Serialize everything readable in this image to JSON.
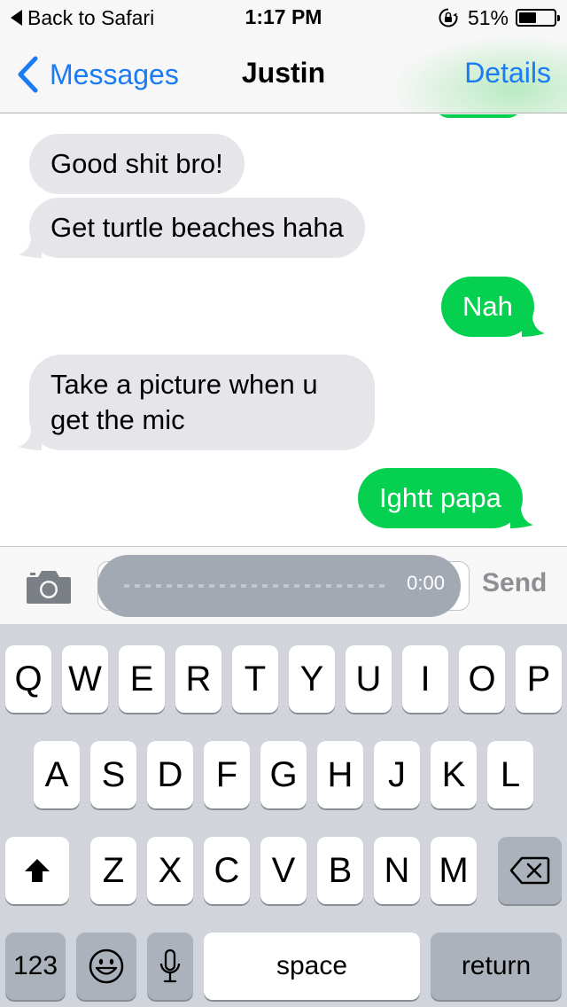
{
  "status_bar": {
    "back_label": "Back to Safari",
    "time": "1:17 PM",
    "battery_text": "51%",
    "battery_level": 0.51,
    "icons": [
      "back-arrow-icon",
      "orientation-lock-icon",
      "battery-icon"
    ]
  },
  "nav": {
    "back_label": "Messages",
    "title": "Justin",
    "details_label": "Details",
    "accent_color": "#1a7bf2"
  },
  "messages": [
    {
      "direction": "incoming",
      "text": "Good shit bro!"
    },
    {
      "direction": "incoming",
      "text": "Get turtle beaches haha"
    },
    {
      "direction": "outgoing",
      "text": "Nah"
    },
    {
      "direction": "incoming",
      "text": "Take a picture when u get the mic"
    },
    {
      "direction": "outgoing",
      "text": "Ightt papa"
    }
  ],
  "bubble_colors": {
    "incoming": "#e5e5ea",
    "outgoing": "#05d04f"
  },
  "composer": {
    "audio_time": "0:00",
    "send_label": "Send",
    "camera_icon": "camera-icon"
  },
  "keyboard": {
    "row1": [
      "Q",
      "W",
      "E",
      "R",
      "T",
      "Y",
      "U",
      "I",
      "O",
      "P"
    ],
    "row2": [
      "A",
      "S",
      "D",
      "F",
      "G",
      "H",
      "J",
      "K",
      "L"
    ],
    "row3": [
      "Z",
      "X",
      "C",
      "V",
      "B",
      "N",
      "M"
    ],
    "numbers_label": "123",
    "space_label": "space",
    "return_label": "return",
    "icons": [
      "shift-icon",
      "delete-icon",
      "emoji-icon",
      "microphone-icon"
    ]
  }
}
